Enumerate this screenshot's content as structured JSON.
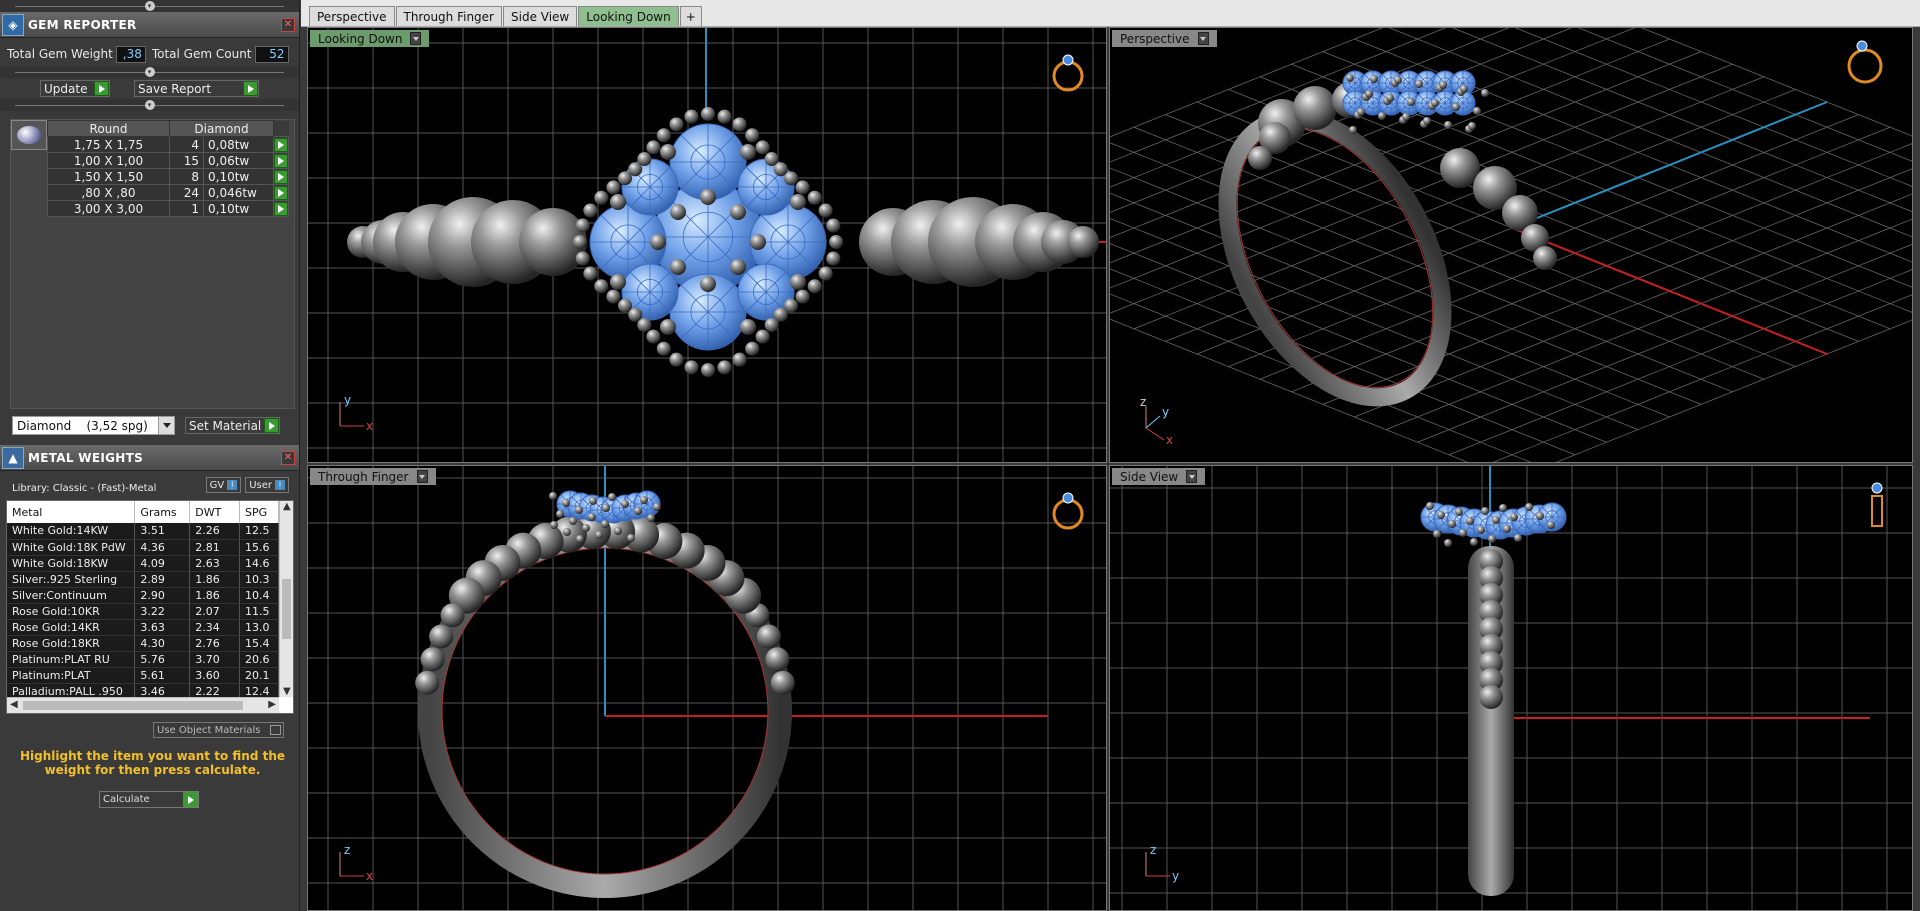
{
  "gem_reporter": {
    "title": "GEM REPORTER",
    "total_weight_label": "Total Gem Weight",
    "total_weight_value": ",38",
    "total_count_label": "Total Gem Count",
    "total_count_value": "52",
    "update_label": "Update",
    "save_report_label": "Save Report",
    "col_shape": "Round",
    "col_type": "Diamond",
    "rows": [
      {
        "size": "1,75 X 1,75",
        "count": "4",
        "weight": "0,08tw"
      },
      {
        "size": "1,00 X 1,00",
        "count": "15",
        "weight": "0,06tw"
      },
      {
        "size": "1,50 X 1,50",
        "count": "8",
        "weight": "0,10tw"
      },
      {
        "size": ",80 X ,80",
        "count": "24",
        "weight": "0,046tw"
      },
      {
        "size": "3,00 X 3,00",
        "count": "1",
        "weight": "0,10tw"
      }
    ],
    "material_select": "Diamond    (3,52 spg)",
    "set_material_label": "Set Material"
  },
  "metal_weights": {
    "title": "METAL WEIGHTS",
    "library": "Library: Classic - (Fast)-Metal",
    "toggle_gv": "GV",
    "toggle_user": "User",
    "headers": [
      "Metal",
      "Grams",
      "DWT",
      "SPG"
    ],
    "rows": [
      [
        "White Gold:14KW",
        "3.51",
        "2.26",
        "12.5"
      ],
      [
        "White Gold:18K PdW",
        "4.36",
        "2.81",
        "15.6"
      ],
      [
        "White Gold:18KW",
        "4.09",
        "2.63",
        "14.6"
      ],
      [
        "Silver:.925 Sterling",
        "2.89",
        "1.86",
        "10.3"
      ],
      [
        "Silver:Continuum",
        "2.90",
        "1.86",
        "10.4"
      ],
      [
        "Rose Gold:10KR",
        "3.22",
        "2.07",
        "11.5"
      ],
      [
        "Rose Gold:14KR",
        "3.63",
        "2.34",
        "13.0"
      ],
      [
        "Rose Gold:18KR",
        "4.30",
        "2.76",
        "15.4"
      ],
      [
        "Platinum:PLAT RU",
        "5.76",
        "3.70",
        "20.6"
      ],
      [
        "Platinum:PLAT",
        "5.61",
        "3.60",
        "20.1"
      ],
      [
        "Palladium:PALL .950",
        "3.46",
        "2.22",
        "12.4"
      ]
    ],
    "use_object_materials": "Use Object Materials",
    "hint": "Highlight the item you want to find the weight for then press calculate.",
    "calculate_label": "Calculate"
  },
  "tabs": [
    "Perspective",
    "Through Finger",
    "Side View",
    "Looking Down"
  ],
  "active_tab": "Looking Down",
  "viewports": {
    "top_left": {
      "label": "Looking Down",
      "axes": [
        "y",
        "x"
      ]
    },
    "top_right": {
      "label": "Perspective",
      "axes": [
        "z",
        "y",
        "x"
      ]
    },
    "bottom_left": {
      "label": "Through Finger",
      "axes": [
        "z",
        "x"
      ]
    },
    "bottom_right": {
      "label": "Side View",
      "axes": [
        "z",
        "y"
      ]
    }
  },
  "colors": {
    "gem": "#6fa0e8",
    "metal": "#8a8a8a",
    "grid": "#4a4a4a",
    "axis_red": "#c82020",
    "axis_blue": "#2a90c0",
    "accent": "#3b9b32"
  }
}
